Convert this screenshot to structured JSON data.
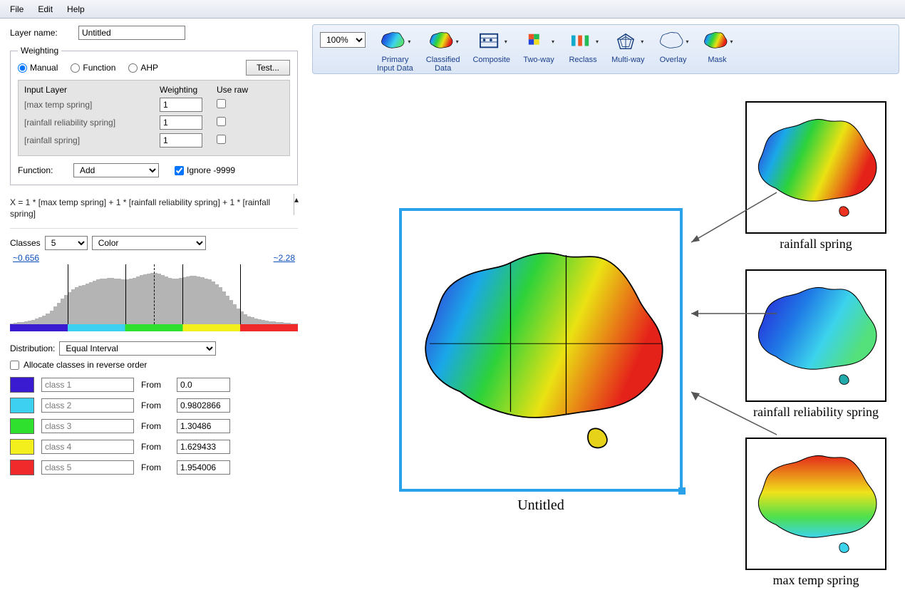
{
  "menu": {
    "file": "File",
    "edit": "Edit",
    "help": "Help"
  },
  "layer_name_label": "Layer name:",
  "layer_name_value": "Untitled",
  "weighting": {
    "legend": "Weighting",
    "manual": "Manual",
    "function": "Function",
    "ahp": "AHP",
    "test_btn": "Test...",
    "hdr_input": "Input Layer",
    "hdr_weight": "Weighting",
    "hdr_raw": "Use raw",
    "rows": [
      {
        "name": "[max temp spring]",
        "weight": "1"
      },
      {
        "name": "[rainfall reliability spring]",
        "weight": "1"
      },
      {
        "name": "[rainfall spring]",
        "weight": "1"
      }
    ],
    "func_label": "Function:",
    "func_value": "Add",
    "ignore_label": "Ignore -9999"
  },
  "formula": "X = 1 * [max temp spring] + 1 * [rainfall reliability spring] + 1 * [rainfall spring]",
  "classes": {
    "label": "Classes",
    "count": "5",
    "color_sel": "Color",
    "min": "~0.656",
    "max": "~2.28",
    "dist_label": "Distribution:",
    "dist_value": "Equal Interval",
    "reverse_label": "Allocate classes in reverse order",
    "list": [
      {
        "color": "#3a1bd1",
        "name": "class 1",
        "from": "0.0"
      },
      {
        "color": "#3ed0f0",
        "name": "class 2",
        "from": "0.9802866"
      },
      {
        "color": "#2fe02f",
        "name": "class 3",
        "from": "1.30486"
      },
      {
        "color": "#f2ef1d",
        "name": "class 4",
        "from": "1.629433"
      },
      {
        "color": "#f02a2a",
        "name": "class 5",
        "from": "1.954006"
      }
    ],
    "from_label": "From"
  },
  "histogram_bars": [
    2,
    3,
    4,
    4,
    5,
    6,
    7,
    9,
    11,
    14,
    17,
    22,
    28,
    34,
    40,
    46,
    50,
    55,
    58,
    60,
    62,
    64,
    66,
    68,
    70,
    71,
    72,
    73,
    73,
    72,
    71,
    70,
    70,
    71,
    73,
    75,
    77,
    78,
    79,
    80,
    80,
    79,
    77,
    75,
    73,
    72,
    72,
    73,
    74,
    75,
    76,
    76,
    75,
    74,
    72,
    70,
    67,
    63,
    58,
    52,
    45,
    38,
    31,
    25,
    20,
    16,
    13,
    11,
    9,
    8,
    7,
    6,
    5,
    5,
    4,
    4,
    3,
    3,
    2,
    2
  ],
  "toolbar": {
    "zoom": "100%",
    "items": [
      {
        "label1": "Primary",
        "label2": "Input Data"
      },
      {
        "label1": "Classified",
        "label2": "Data"
      },
      {
        "label1": "Composite",
        "label2": ""
      },
      {
        "label1": "Two-way",
        "label2": ""
      },
      {
        "label1": "Reclass",
        "label2": ""
      },
      {
        "label1": "Multi-way",
        "label2": ""
      },
      {
        "label1": "Overlay",
        "label2": ""
      },
      {
        "label1": "Mask",
        "label2": ""
      }
    ]
  },
  "maps": {
    "main_label": "Untitled",
    "thumbs": [
      {
        "label": "rainfall spring"
      },
      {
        "label": "rainfall reliability spring"
      },
      {
        "label": "max temp spring"
      }
    ]
  }
}
